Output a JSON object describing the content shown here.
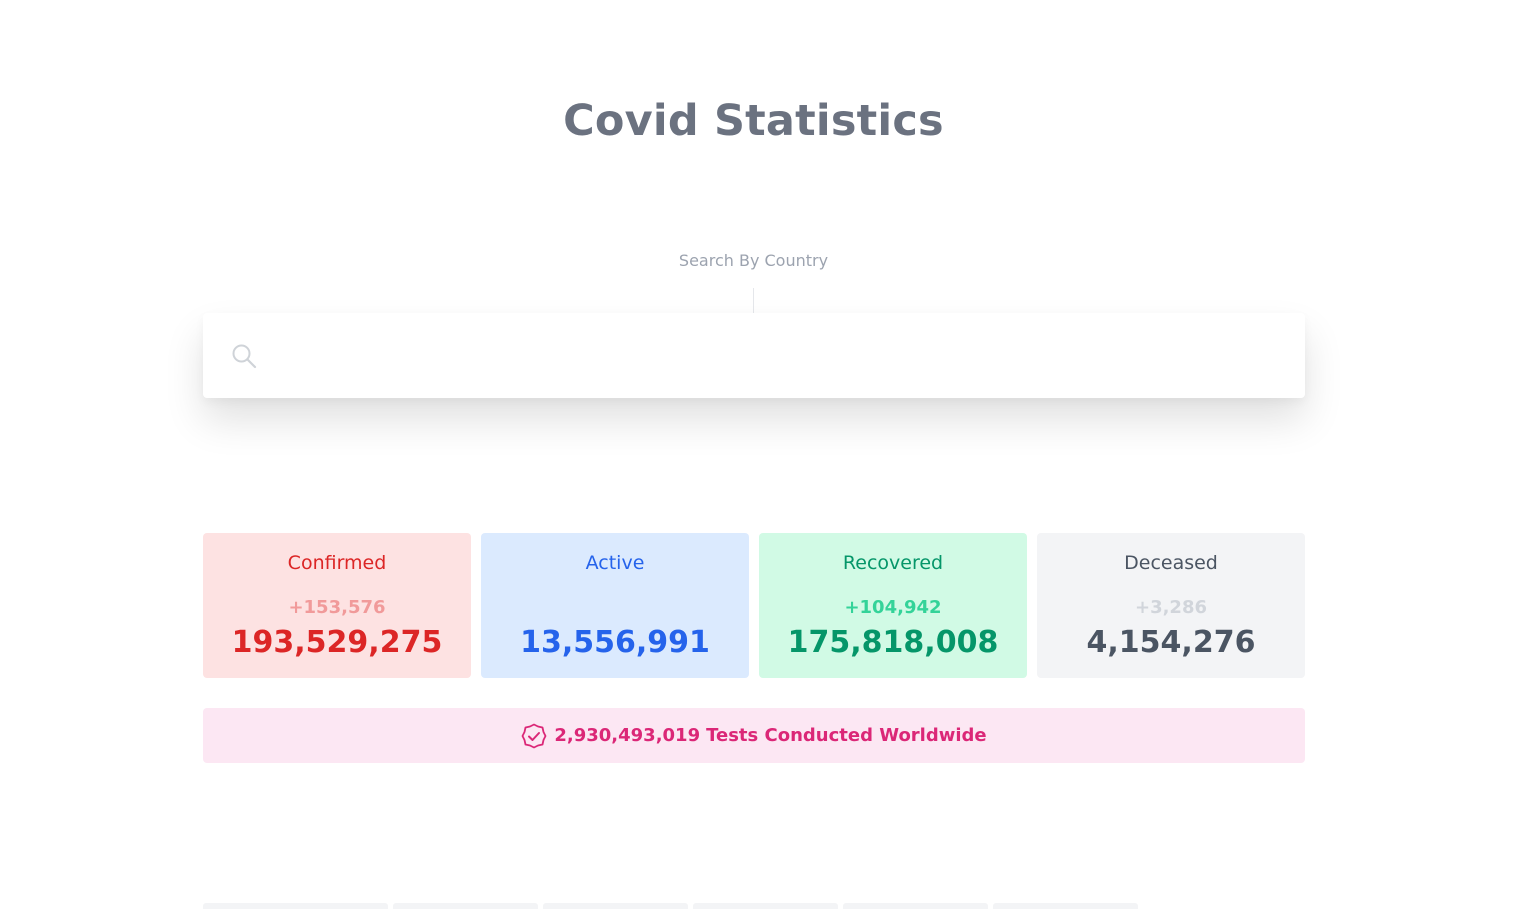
{
  "page": {
    "title": "Covid Statistics"
  },
  "search": {
    "label": "Search By Country",
    "value": "",
    "placeholder": "",
    "icon": "search-icon"
  },
  "stats": {
    "confirmed": {
      "label": "Confirmed",
      "delta": "+153,576",
      "value": "193,529,275",
      "color": "#dc2626"
    },
    "active": {
      "label": "Active",
      "delta": "",
      "value": "13,556,991",
      "color": "#2563eb"
    },
    "recovered": {
      "label": "Recovered",
      "delta": "+104,942",
      "value": "175,818,008",
      "color": "#059669"
    },
    "deceased": {
      "label": "Deceased",
      "delta": "+3,286",
      "value": "4,154,276",
      "color": "#4b5563"
    }
  },
  "tests": {
    "count": "2,930,493,019",
    "label": "Tests Conducted Worldwide",
    "icon": "verified-badge-icon",
    "color": "#db2777"
  }
}
